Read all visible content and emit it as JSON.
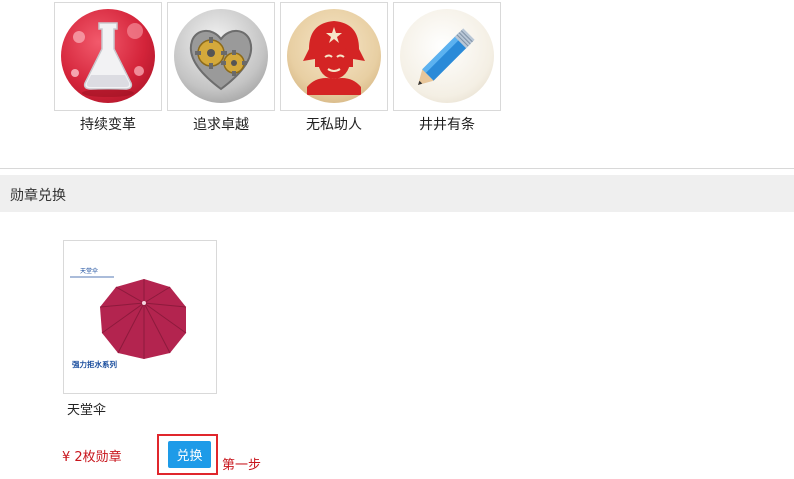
{
  "badges": [
    {
      "label": "持续变革",
      "icon": "flask-icon"
    },
    {
      "label": "追求卓越",
      "icon": "gears-icon"
    },
    {
      "label": "无私助人",
      "icon": "soldier-portrait-icon"
    },
    {
      "label": "井井有条",
      "icon": "pencil-icon"
    }
  ],
  "section": {
    "title": "勋章兑换"
  },
  "product": {
    "name": "天堂伞",
    "image_icon": "umbrella-image",
    "image_brand_text": "天堂伞",
    "image_caption": "强力拒水系列",
    "price": "¥ 2枚勋章",
    "button_label": "兑换",
    "step_note": "第一步"
  },
  "colors": {
    "accent_button": "#1e9be8",
    "price_text": "#c8161d",
    "highlight_border": "#e0262c"
  }
}
